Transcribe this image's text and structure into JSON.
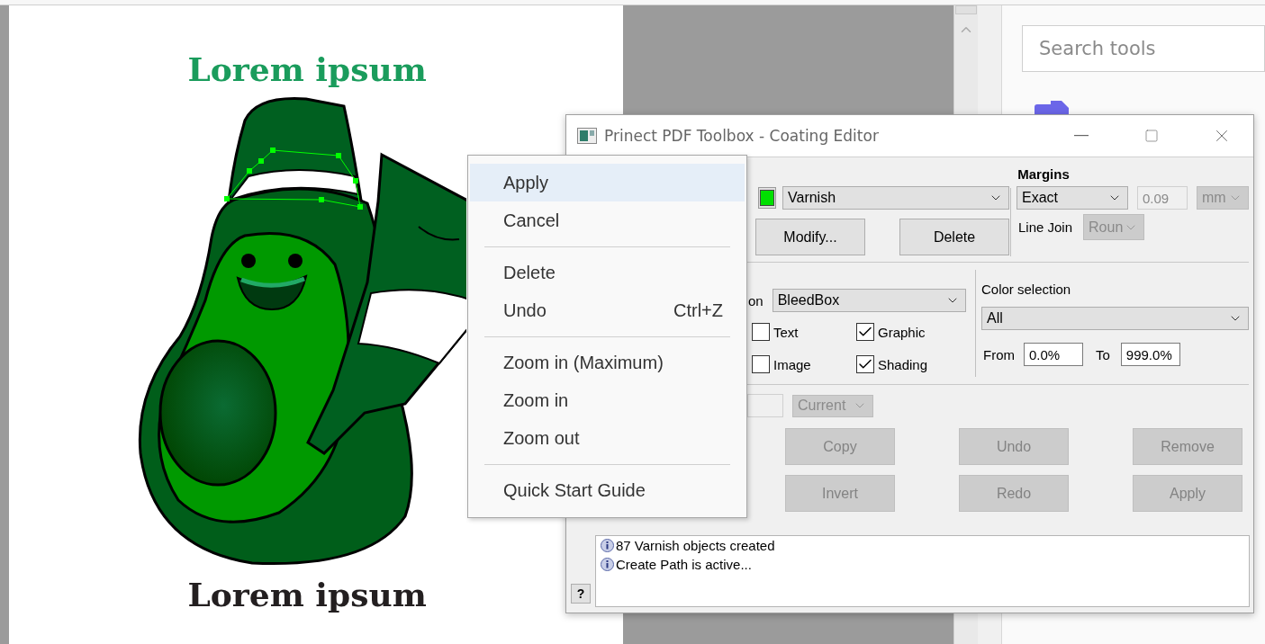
{
  "document": {
    "heading": "Lorem ipsum",
    "caption": "Lorem ipsum"
  },
  "side_panel": {
    "search": {
      "placeholder": "Search tools"
    }
  },
  "dialog": {
    "title": "Prinect PDF Toolbox - Coating Editor",
    "layer": {
      "type": "Varnish",
      "buttons": [
        "Modify...",
        "Delete"
      ]
    },
    "margins": {
      "title": "Margins",
      "mode": "Exact",
      "value": {
        "text": "0.09",
        "disabled": true
      },
      "unit": {
        "text": "mm",
        "disabled": true
      },
      "line_join_label": "Line Join",
      "line_join": {
        "text": "Roun",
        "disabled": true
      }
    },
    "scope": {
      "label_fragment": "on",
      "box": "BleedBox",
      "object_types": [
        {
          "label": "Text",
          "checked": false
        },
        {
          "label": "Graphic",
          "checked": true
        },
        {
          "label": "Image",
          "checked": false
        },
        {
          "label": "Shading",
          "checked": true
        }
      ]
    },
    "color_selection": {
      "label": "Color selection",
      "value": "All",
      "from_label": "From",
      "from": "0.0%",
      "to_label": "To",
      "to": "999.0%"
    },
    "page_select": {
      "mode": "Current",
      "disabled": true
    },
    "actions": [
      {
        "label": "Copy",
        "disabled": true
      },
      {
        "label": "Undo",
        "disabled": true
      },
      {
        "label": "Remove",
        "disabled": true
      },
      {
        "label": "Invert",
        "disabled": true
      },
      {
        "label": "Redo",
        "disabled": true
      },
      {
        "label": "Apply",
        "disabled": true
      }
    ],
    "log": [
      {
        "text": "87 Varnish objects created"
      },
      {
        "text": "Create Path is active..."
      }
    ],
    "help": "?"
  },
  "context_menu": [
    {
      "kind": "item",
      "label": "Apply",
      "selected": true
    },
    {
      "kind": "item",
      "label": "Cancel",
      "selected": false
    },
    {
      "kind": "separator"
    },
    {
      "kind": "item",
      "label": "Delete",
      "selected": false
    },
    {
      "kind": "item",
      "label": "Undo",
      "shortcut": "Ctrl+Z",
      "selected": false
    },
    {
      "kind": "separator"
    },
    {
      "kind": "item",
      "label": "Zoom in (Maximum)",
      "selected": false
    },
    {
      "kind": "item",
      "label": "Zoom in",
      "selected": false
    },
    {
      "kind": "item",
      "label": "Zoom out",
      "selected": false
    },
    {
      "kind": "separator"
    },
    {
      "kind": "item",
      "label": "Quick Start Guide",
      "selected": false
    }
  ]
}
